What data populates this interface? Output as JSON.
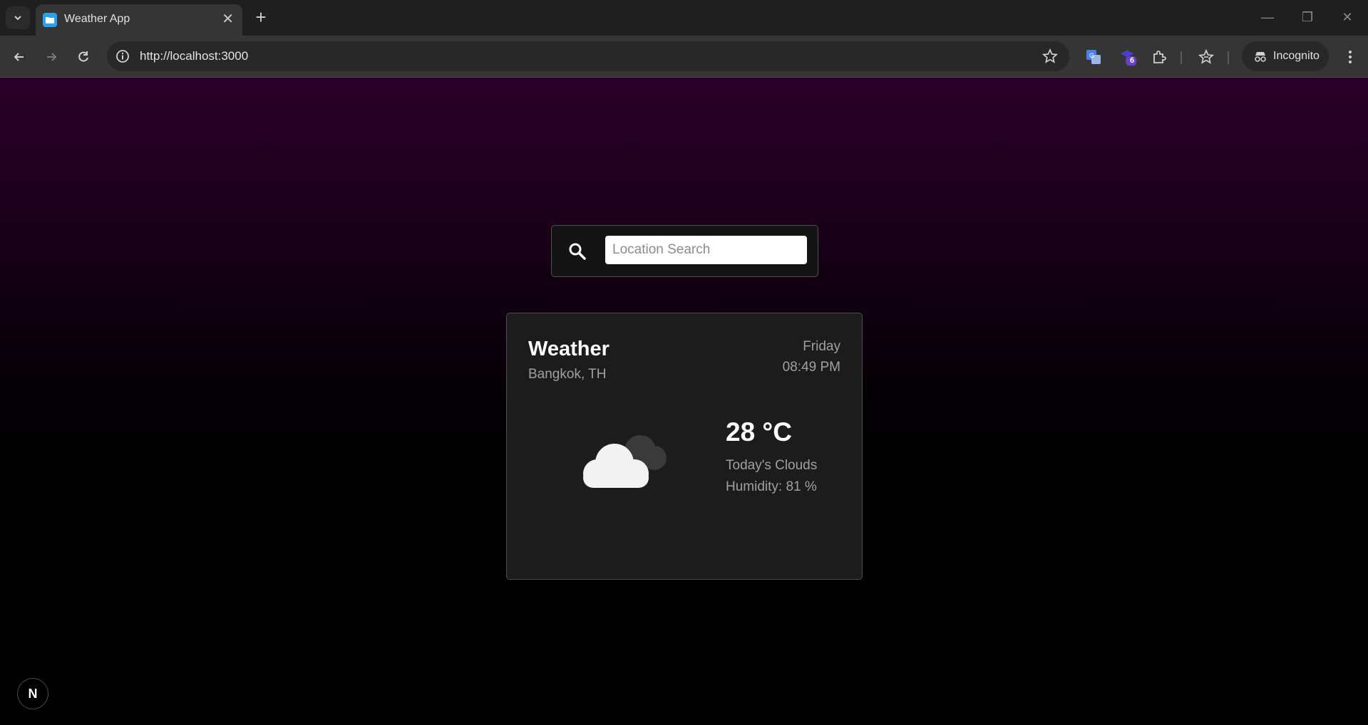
{
  "browser": {
    "tab": {
      "title": "Weather App"
    },
    "address_bar": {
      "url": "http://localhost:3000"
    },
    "extensions": {
      "badge_count": "6"
    },
    "incognito_label": "Incognito"
  },
  "search": {
    "placeholder": "Location Search",
    "value": ""
  },
  "weather": {
    "title": "Weather",
    "location": "Bangkok, TH",
    "day": "Friday",
    "time": "08:49 PM",
    "temperature": "28 °C",
    "description": "Today's Clouds",
    "humidity": "Humidity: 81 %",
    "icon": "cloud-icon"
  },
  "dev_badge": {
    "label": "N"
  },
  "colors": {
    "background_top": "#2b0029",
    "card_bg": "#1c1c1c",
    "text_muted": "#a0a0a0",
    "favicon": "#2aa2e8"
  }
}
